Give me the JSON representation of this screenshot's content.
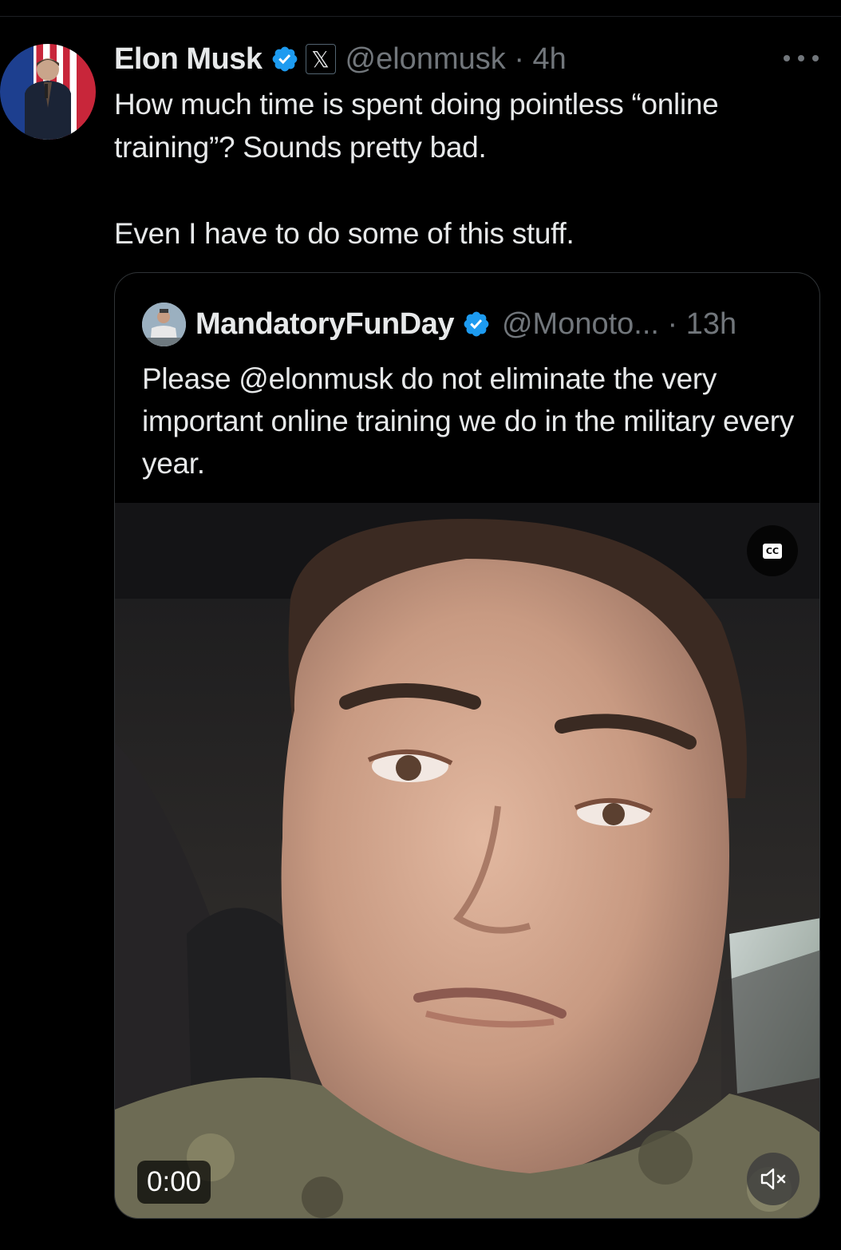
{
  "tweet": {
    "author_name": "Elon Musk",
    "x_badge": "𝕏",
    "handle": "@elonmusk",
    "separator": "·",
    "time": "4h",
    "text_line1": "How much time is spent doing pointless “online training”? Sounds pretty bad.",
    "text_line2": "Even I have to do some of this stuff."
  },
  "quoted": {
    "author_name": "MandatoryFunDay",
    "handle": "@Monoto...",
    "separator": "·",
    "time": "13h",
    "text": "Please @elonmusk do not eliminate the very important online training we do in the military every year."
  },
  "video": {
    "timestamp": "0:00",
    "cc_label": "CC"
  },
  "colors": {
    "background": "#000000",
    "text_primary": "#e7e9ea",
    "text_secondary": "#71767b",
    "verified_blue": "#1d9bf0",
    "border": "#2f3336"
  },
  "icons": [
    "verified-badge-icon",
    "x-logo-icon",
    "more-options-icon",
    "closed-captions-icon",
    "muted-speaker-icon"
  ]
}
